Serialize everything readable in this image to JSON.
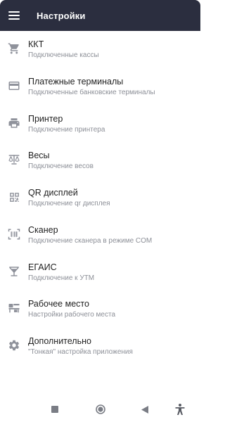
{
  "colors": {
    "app_bar_bg": "#2b2e3f",
    "icon": "#8f929b",
    "title_text": "#1f1f1f",
    "subtitle_text": "#8c8f97"
  },
  "header": {
    "title": "Настройки",
    "menu_icon": "menu-icon"
  },
  "settings": {
    "items": [
      {
        "icon": "cart-icon",
        "title": "ККТ",
        "subtitle": "Подключенные кассы"
      },
      {
        "icon": "credit-card-icon",
        "title": "Платежные терминалы",
        "subtitle": "Подключенные банковские терминалы"
      },
      {
        "icon": "printer-icon",
        "title": "Принтер",
        "subtitle": "Подключение принтера"
      },
      {
        "icon": "scales-icon",
        "title": "Весы",
        "subtitle": "Подключение весов"
      },
      {
        "icon": "qr-code-icon",
        "title": "QR дисплей",
        "subtitle": "Подключение qr дисплея"
      },
      {
        "icon": "barcode-scanner-icon",
        "title": "Сканер",
        "subtitle": "Подключение сканера в режиме COM"
      },
      {
        "icon": "glass-icon",
        "title": "ЕГАИС",
        "subtitle": "Подключение к УТМ"
      },
      {
        "icon": "workplace-icon",
        "title": "Рабочее место",
        "subtitle": "Настройки рабочего места"
      },
      {
        "icon": "gear-icon",
        "title": "Дополнительно",
        "subtitle": "\"Тонкая\" настройка приложения"
      }
    ]
  },
  "nav_bar": {
    "buttons": [
      "recent-apps-icon",
      "home-icon",
      "back-icon",
      "accessibility-icon"
    ]
  }
}
